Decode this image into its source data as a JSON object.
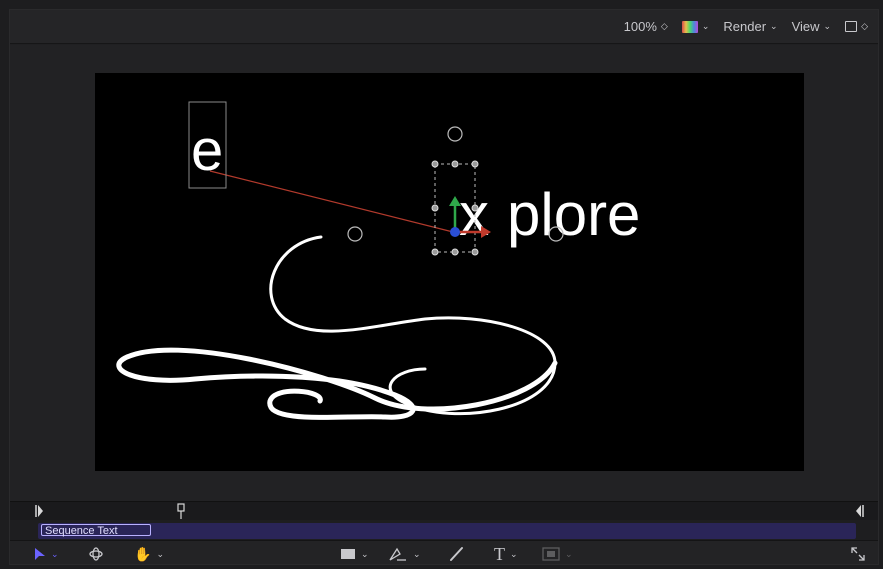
{
  "toolbar": {
    "zoom_value": "100%",
    "zoom_stepper": "◇",
    "color_chevron": "⌄",
    "render_label": "Render",
    "view_label": "View",
    "chevron": "⌄"
  },
  "canvas": {
    "letter_e": "e",
    "letter_x": "x",
    "word_plore": "plore",
    "background_color": "#000000"
  },
  "timeline": {
    "clip_label": "Sequence Text",
    "clip_color": "#2a2558"
  },
  "bottom_toolbar": {
    "text_tool_glyph": "T",
    "chevron": "⌄"
  },
  "icons": [
    "select-arrow-icon",
    "transform-3d-icon",
    "hand-icon",
    "rectangle-shape-icon",
    "pen-icon",
    "paint-stroke-icon",
    "text-icon",
    "mask-icon",
    "fullscreen-icon",
    "color-channels-icon",
    "layout-icon"
  ]
}
